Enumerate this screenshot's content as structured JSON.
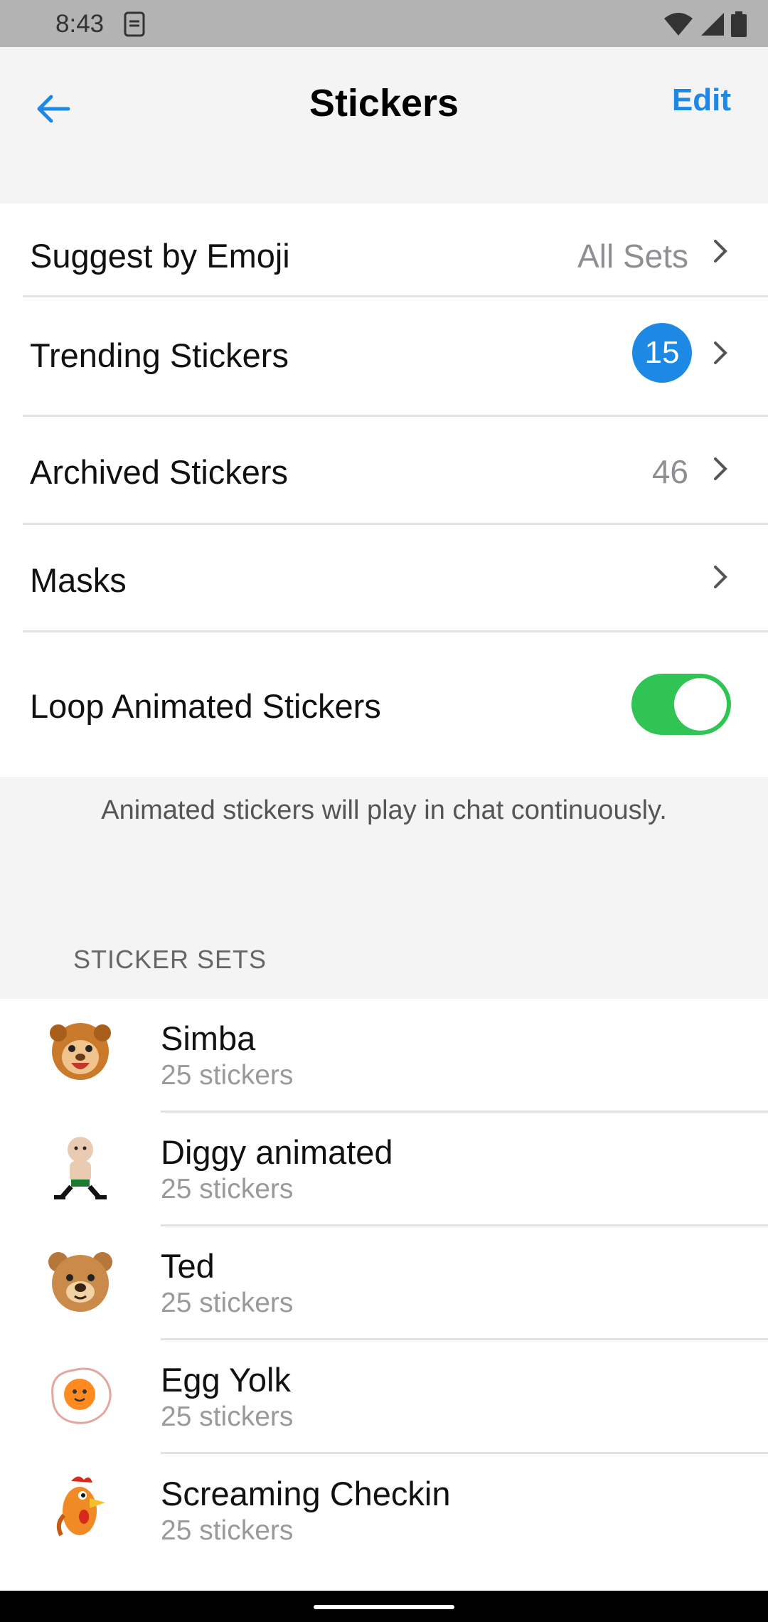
{
  "status_bar": {
    "time": "8:43",
    "icons": [
      "sim-card-icon",
      "wifi-icon",
      "signal-icon",
      "battery-icon"
    ]
  },
  "header": {
    "title": "Stickers",
    "edit_label": "Edit",
    "back_icon": "arrow-left-icon"
  },
  "settings": {
    "suggest": {
      "label": "Suggest by Emoji",
      "value": "All Sets"
    },
    "trending": {
      "label": "Trending Stickers",
      "badge": "15"
    },
    "archived": {
      "label": "Archived Stickers",
      "value": "46"
    },
    "masks": {
      "label": "Masks"
    },
    "loop": {
      "label": "Loop Animated Stickers",
      "enabled": true
    }
  },
  "hint": "Animated stickers will play in chat continuously.",
  "section_header": "STICKER SETS",
  "sticker_sets": [
    {
      "name": "Simba",
      "count": "25 stickers",
      "icon": "lion-cub-icon"
    },
    {
      "name": "Diggy animated",
      "count": "25 stickers",
      "icon": "diggy-character-icon"
    },
    {
      "name": "Ted",
      "count": "25 stickers",
      "icon": "teddy-bear-icon"
    },
    {
      "name": "Egg Yolk",
      "count": "25 stickers",
      "icon": "fried-egg-icon"
    },
    {
      "name": "Screaming Checkin",
      "count": "25 stickers",
      "icon": "rooster-icon"
    }
  ],
  "colors": {
    "accent": "#1e88e5",
    "toggle_on": "#30c455",
    "muted": "#8e8e93"
  }
}
